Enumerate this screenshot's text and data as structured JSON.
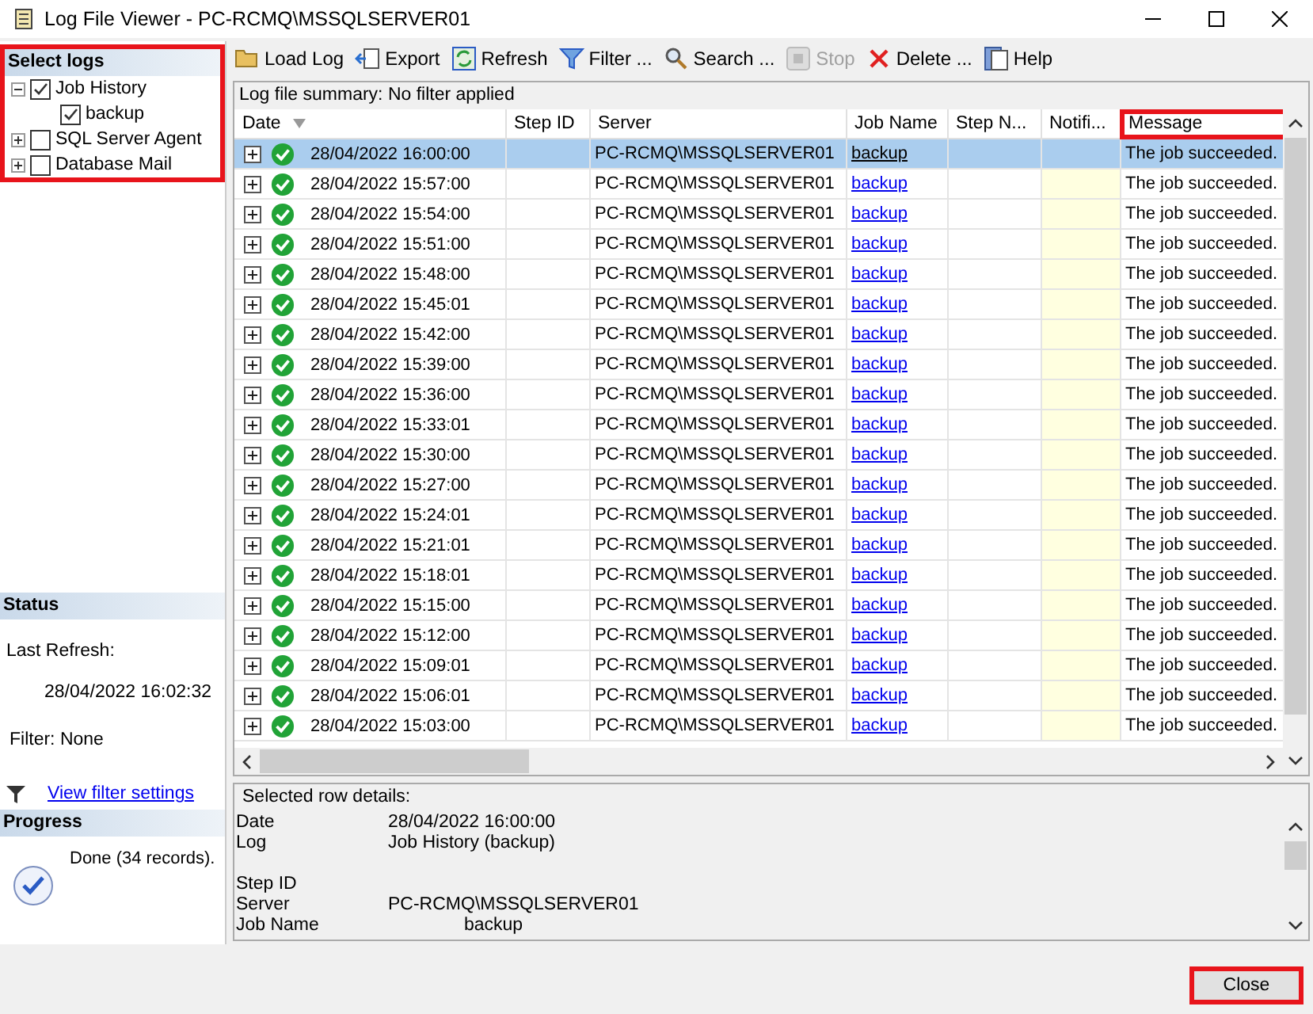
{
  "window": {
    "title": "Log File Viewer - PC-RCMQ\\MSSQLSERVER01"
  },
  "select_logs": {
    "title": "Select logs",
    "highlighted": true,
    "items": [
      {
        "label": "Job History",
        "checked": true,
        "expanded": true,
        "children": [
          {
            "label": "backup",
            "checked": true
          }
        ]
      },
      {
        "label": "SQL Server Agent",
        "checked": false,
        "expanded": false
      },
      {
        "label": "Database Mail",
        "checked": false,
        "expanded": false
      }
    ]
  },
  "status": {
    "title": "Status",
    "last_refresh_label": "Last Refresh:",
    "last_refresh_value": "28/04/2022 16:02:32",
    "filter": "Filter: None",
    "filter_link": "View filter settings"
  },
  "progress": {
    "title": "Progress",
    "message": "Done (34 records)."
  },
  "toolbar": [
    {
      "kind": "folder",
      "label": "Load Log",
      "disabled": false
    },
    {
      "kind": "export",
      "label": "Export",
      "disabled": false
    },
    {
      "kind": "refresh",
      "label": "Refresh",
      "disabled": false
    },
    {
      "kind": "filter",
      "label": "Filter ...",
      "disabled": false
    },
    {
      "kind": "search",
      "label": "Search ...",
      "disabled": false
    },
    {
      "kind": "stop",
      "label": "Stop",
      "disabled": true
    },
    {
      "kind": "delete",
      "label": "Delete ...",
      "disabled": false
    },
    {
      "kind": "help",
      "label": "Help",
      "disabled": false
    }
  ],
  "grid": {
    "summary": "Log file summary: No filter applied",
    "columns": [
      {
        "label": "Date",
        "highlighted": false
      },
      {
        "label": "Step ID",
        "highlighted": false
      },
      {
        "label": "Server",
        "highlighted": false
      },
      {
        "label": "Job Name",
        "highlighted": false
      },
      {
        "label": "Step N...",
        "highlighted": false
      },
      {
        "label": "Notifi...",
        "highlighted": false
      },
      {
        "label": "Message",
        "highlighted": true
      }
    ],
    "rows": [
      {
        "date": "28/04/2022 16:00:00",
        "server": "PC-RCMQ\\MSSQLSERVER01",
        "job": "backup",
        "message": "The job succeeded.",
        "selected": true
      },
      {
        "date": "28/04/2022 15:57:00",
        "server": "PC-RCMQ\\MSSQLSERVER01",
        "job": "backup",
        "message": "The job succeeded.",
        "selected": false
      },
      {
        "date": "28/04/2022 15:54:00",
        "server": "PC-RCMQ\\MSSQLSERVER01",
        "job": "backup",
        "message": "The job succeeded.",
        "selected": false
      },
      {
        "date": "28/04/2022 15:51:00",
        "server": "PC-RCMQ\\MSSQLSERVER01",
        "job": "backup",
        "message": "The job succeeded.",
        "selected": false
      },
      {
        "date": "28/04/2022 15:48:00",
        "server": "PC-RCMQ\\MSSQLSERVER01",
        "job": "backup",
        "message": "The job succeeded.",
        "selected": false
      },
      {
        "date": "28/04/2022 15:45:01",
        "server": "PC-RCMQ\\MSSQLSERVER01",
        "job": "backup",
        "message": "The job succeeded.",
        "selected": false
      },
      {
        "date": "28/04/2022 15:42:00",
        "server": "PC-RCMQ\\MSSQLSERVER01",
        "job": "backup",
        "message": "The job succeeded.",
        "selected": false
      },
      {
        "date": "28/04/2022 15:39:00",
        "server": "PC-RCMQ\\MSSQLSERVER01",
        "job": "backup",
        "message": "The job succeeded.",
        "selected": false
      },
      {
        "date": "28/04/2022 15:36:00",
        "server": "PC-RCMQ\\MSSQLSERVER01",
        "job": "backup",
        "message": "The job succeeded.",
        "selected": false
      },
      {
        "date": "28/04/2022 15:33:01",
        "server": "PC-RCMQ\\MSSQLSERVER01",
        "job": "backup",
        "message": "The job succeeded.",
        "selected": false
      },
      {
        "date": "28/04/2022 15:30:00",
        "server": "PC-RCMQ\\MSSQLSERVER01",
        "job": "backup",
        "message": "The job succeeded.",
        "selected": false
      },
      {
        "date": "28/04/2022 15:27:00",
        "server": "PC-RCMQ\\MSSQLSERVER01",
        "job": "backup",
        "message": "The job succeeded.",
        "selected": false
      },
      {
        "date": "28/04/2022 15:24:01",
        "server": "PC-RCMQ\\MSSQLSERVER01",
        "job": "backup",
        "message": "The job succeeded.",
        "selected": false
      },
      {
        "date": "28/04/2022 15:21:01",
        "server": "PC-RCMQ\\MSSQLSERVER01",
        "job": "backup",
        "message": "The job succeeded.",
        "selected": false
      },
      {
        "date": "28/04/2022 15:18:01",
        "server": "PC-RCMQ\\MSSQLSERVER01",
        "job": "backup",
        "message": "The job succeeded.",
        "selected": false
      },
      {
        "date": "28/04/2022 15:15:00",
        "server": "PC-RCMQ\\MSSQLSERVER01",
        "job": "backup",
        "message": "The job succeeded.",
        "selected": false
      },
      {
        "date": "28/04/2022 15:12:00",
        "server": "PC-RCMQ\\MSSQLSERVER01",
        "job": "backup",
        "message": "The job succeeded.",
        "selected": false
      },
      {
        "date": "28/04/2022 15:09:01",
        "server": "PC-RCMQ\\MSSQLSERVER01",
        "job": "backup",
        "message": "The job succeeded.",
        "selected": false
      },
      {
        "date": "28/04/2022 15:06:01",
        "server": "PC-RCMQ\\MSSQLSERVER01",
        "job": "backup",
        "message": "The job succeeded.",
        "selected": false
      },
      {
        "date": "28/04/2022 15:03:00",
        "server": "PC-RCMQ\\MSSQLSERVER01",
        "job": "backup",
        "message": "The job succeeded.",
        "selected": false
      }
    ]
  },
  "details": {
    "title": "Selected row details:",
    "fields": [
      {
        "label": "Date",
        "value": "28/04/2022 16:00:00",
        "kind": "normal"
      },
      {
        "label": "Log",
        "value": "Job History (backup)",
        "kind": "normal"
      },
      {
        "label": "Step ID",
        "kind": "spaced"
      },
      {
        "label": "Server",
        "value": "PC-RCMQ\\MSSQLSERVER01",
        "kind": "normal"
      },
      {
        "label": "Job Name",
        "value": "backup",
        "kind": "indented"
      }
    ]
  },
  "close_button": {
    "label": "Close",
    "highlighted": true
  }
}
